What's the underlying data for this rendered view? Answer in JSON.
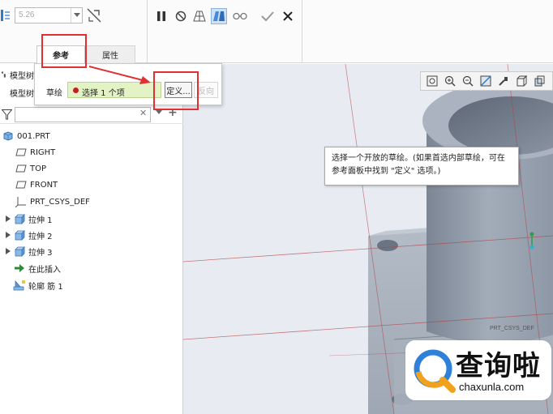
{
  "ribbon": {
    "thickness_value": "5.26",
    "tabs": {
      "references": "参考",
      "properties": "属性"
    },
    "icons": [
      "thickness-icon",
      "flip-direction-icon",
      "pause-icon",
      "no-preview-icon",
      "preview-icon",
      "verify-icon",
      "glasses-preview-icon",
      "ok-icon",
      "cancel-icon"
    ]
  },
  "references_panel": {
    "sketch_label": "草绘",
    "collector_text": "选择 1 个项",
    "define_label": "定义...",
    "reverse_label": "反向"
  },
  "model_tree": {
    "title": "模型树",
    "tab_label": "模型树",
    "root": "001.PRT",
    "items": [
      {
        "label": "RIGHT",
        "icon": "datum-plane-icon"
      },
      {
        "label": "TOP",
        "icon": "datum-plane-icon"
      },
      {
        "label": "FRONT",
        "icon": "datum-plane-icon"
      },
      {
        "label": "PRT_CSYS_DEF",
        "icon": "csys-icon"
      },
      {
        "label": "拉伸 1",
        "icon": "extrude-icon"
      },
      {
        "label": "拉伸 2",
        "icon": "extrude-icon"
      },
      {
        "label": "拉伸 3",
        "icon": "extrude-icon"
      },
      {
        "label": "在此插入",
        "icon": "insert-here-icon"
      },
      {
        "label": "轮廓 筋 1",
        "icon": "profile-rib-icon"
      }
    ]
  },
  "graphics": {
    "tooltip": "选择一个开放的草绘。(如果首选内部草绘，可在参考面板中找到 \"定义\" 选项。)",
    "csys_label": "PRT_CSYS_DEF",
    "view_toolbar_icons": [
      "refit-icon",
      "zoom-in-icon",
      "zoom-out-icon",
      "repaint-icon",
      "display-style-icon",
      "saved-views-icon",
      "view-manager-icon"
    ]
  },
  "watermark": {
    "brand": "查询啦",
    "domain": "chaxunla.com"
  },
  "colors": {
    "annotation_red": "#e03030",
    "collector_green": "#e4f3c6",
    "model_gray": "#8e98a6",
    "datum_red": "#b04545"
  }
}
